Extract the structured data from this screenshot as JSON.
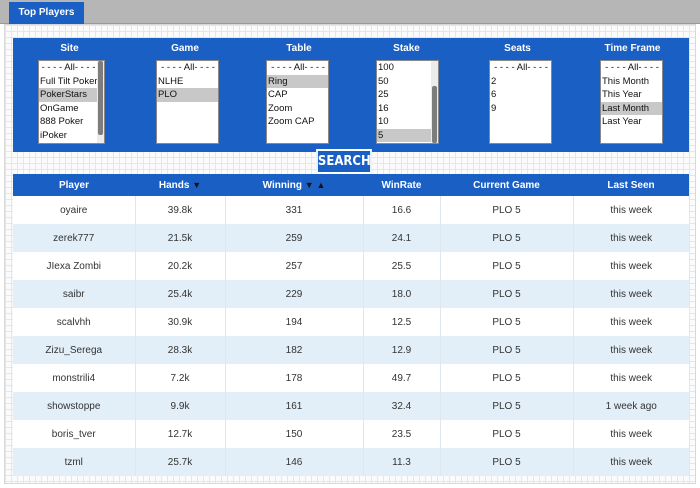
{
  "tab": {
    "label": "Top Players"
  },
  "filters": [
    {
      "key": "site",
      "label": "Site",
      "options": [
        "- - - - All- - - -",
        "Full Tilt Poker",
        "PokerStars",
        "OnGame",
        "888 Poker",
        "iPoker"
      ],
      "selected": [
        "PokerStars"
      ],
      "scroll": {
        "thumb_fraction": 0.9,
        "position": 0
      }
    },
    {
      "key": "game",
      "label": "Game",
      "options": [
        "- - - - All- - - -",
        "NLHE",
        "PLO"
      ],
      "selected": [
        "PLO"
      ]
    },
    {
      "key": "table",
      "label": "Table",
      "options": [
        "- - - - All- - - -",
        "Ring",
        "CAP",
        "Zoom",
        "Zoom CAP"
      ],
      "selected": [
        "Ring"
      ]
    },
    {
      "key": "stake",
      "label": "Stake",
      "options": [
        "100",
        "50",
        "25",
        "16",
        "10",
        "5"
      ],
      "selected": [
        "5"
      ],
      "scroll": {
        "thumb_fraction": 0.7,
        "position": 1
      }
    },
    {
      "key": "seats",
      "label": "Seats",
      "options": [
        "- - - - All- - - -",
        "2",
        "6",
        "9"
      ],
      "selected": []
    },
    {
      "key": "timeframe",
      "label": "Time Frame",
      "options": [
        "- - - - All- - - -",
        "This Month",
        "This Year",
        "Last Month",
        "Last Year"
      ],
      "selected": [
        "Last Month"
      ]
    }
  ],
  "search": {
    "label": "SEARCH"
  },
  "table": {
    "columns": {
      "player": "Player",
      "hands": "Hands",
      "winning": "Winning",
      "winrate": "WinRate",
      "game": "Current Game",
      "seen": "Last Seen"
    },
    "sort_down_icon": "▼",
    "sort_up_icon": "▲",
    "rows": [
      {
        "player": "oyaire",
        "hands": "39.8k",
        "winning": "331",
        "winrate": "16.6",
        "game": "PLO 5",
        "seen": "this week"
      },
      {
        "player": "zerek777",
        "hands": "21.5k",
        "winning": "259",
        "winrate": "24.1",
        "game": "PLO 5",
        "seen": "this week"
      },
      {
        "player": "JIexa Zombi",
        "hands": "20.2k",
        "winning": "257",
        "winrate": "25.5",
        "game": "PLO 5",
        "seen": "this week"
      },
      {
        "player": "saibr",
        "hands": "25.4k",
        "winning": "229",
        "winrate": "18.0",
        "game": "PLO 5",
        "seen": "this week"
      },
      {
        "player": "scalvhh",
        "hands": "30.9k",
        "winning": "194",
        "winrate": "12.5",
        "game": "PLO 5",
        "seen": "this week"
      },
      {
        "player": "Zizu_Serega",
        "hands": "28.3k",
        "winning": "182",
        "winrate": "12.9",
        "game": "PLO 5",
        "seen": "this week"
      },
      {
        "player": "monstrili4",
        "hands": "7.2k",
        "winning": "178",
        "winrate": "49.7",
        "game": "PLO 5",
        "seen": "this week"
      },
      {
        "player": "showstoppe",
        "hands": "9.9k",
        "winning": "161",
        "winrate": "32.4",
        "game": "PLO 5",
        "seen": "1 week ago"
      },
      {
        "player": "boris_tver",
        "hands": "12.7k",
        "winning": "150",
        "winrate": "23.5",
        "game": "PLO 5",
        "seen": "this week"
      },
      {
        "player": "tzml",
        "hands": "25.7k",
        "winning": "146",
        "winrate": "11.3",
        "game": "PLO 5",
        "seen": "this week"
      }
    ]
  },
  "colors": {
    "accent": "#1a5fc4",
    "row_alt": "#e2eff8",
    "selected_option": "#c8c8c8"
  }
}
